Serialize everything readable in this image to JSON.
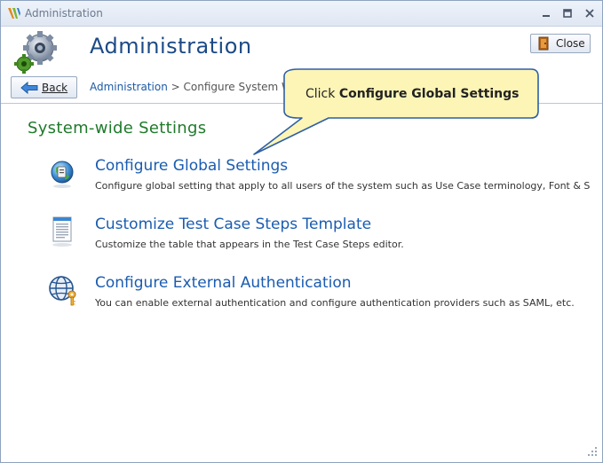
{
  "window": {
    "title": "Administration",
    "minimize_glyph": "▬",
    "maximize_glyph": "■",
    "close_glyph": "✕"
  },
  "header": {
    "title": "Administration",
    "close_label": "Close",
    "back_label": "Back",
    "breadcrumb": {
      "link": "Administration",
      "separator": " > ",
      "current": "Configure System W"
    }
  },
  "section": {
    "title": "System-wide Settings"
  },
  "items": [
    {
      "title": "Configure Global Settings",
      "description": "Configure global setting that apply to all users of the system such as Use Case terminology, Font & S",
      "icon": "globe-settings-icon"
    },
    {
      "title": "Customize Test Case Steps Template",
      "description": "Customize the table that appears in the Test Case Steps editor.",
      "icon": "document-template-icon"
    },
    {
      "title": "Configure External Authentication",
      "description": "You can enable external authentication and configure authentication providers such as SAML, etc.",
      "icon": "globe-key-icon"
    }
  ],
  "tooltip": {
    "prefix": "Click ",
    "emphasis": "Configure Global Settings"
  },
  "colors": {
    "title_blue": "#1c4a86",
    "link_blue": "#1a5cb0",
    "section_green": "#1f7a2b",
    "callout_fill": "#fdf5b6",
    "callout_border": "#2f5fa6"
  }
}
